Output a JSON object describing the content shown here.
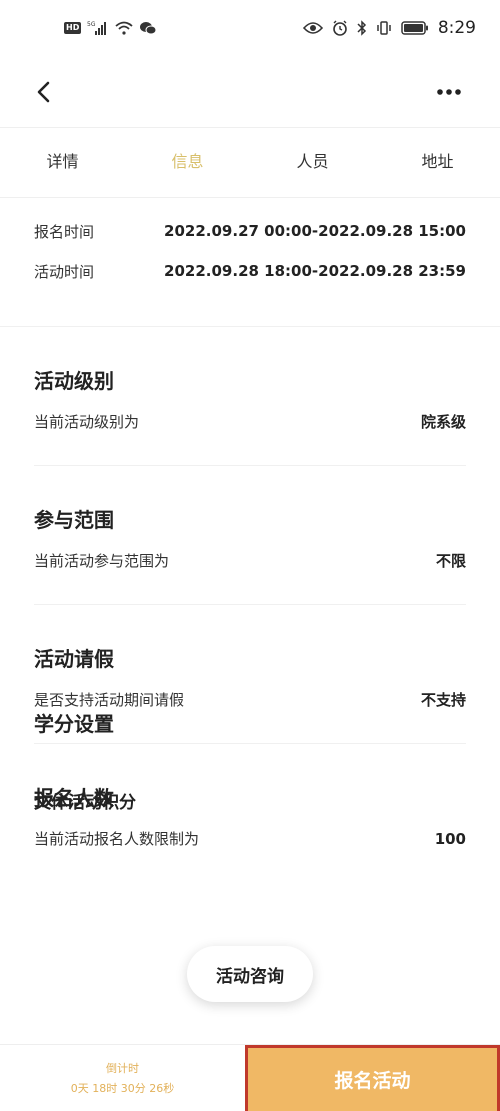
{
  "status_bar": {
    "hd": "HD",
    "network": "5G",
    "time": "8:29"
  },
  "tabs": [
    {
      "label": "详情"
    },
    {
      "label": "信息"
    },
    {
      "label": "人员"
    },
    {
      "label": "地址"
    }
  ],
  "active_tab": "信息",
  "times": {
    "signup_label": "报名时间",
    "signup_value": "2022.09.27 00:00-2022.09.28 15:00",
    "activity_label": "活动时间",
    "activity_value": "2022.09.28 18:00-2022.09.28 23:59"
  },
  "sections": {
    "level": {
      "title": "活动级别",
      "label": "当前活动级别为",
      "value": "院系级"
    },
    "scope": {
      "title": "参与范围",
      "label": "当前活动参与范围为",
      "value": "不限"
    },
    "leave": {
      "title": "活动请假",
      "label": "是否支持活动期间请假",
      "value": "不支持"
    },
    "capacity": {
      "title": "报名人数",
      "label": "当前活动报名人数限制为",
      "value": "100"
    }
  },
  "credits": {
    "title": "学分设置",
    "subtitle": "文体活动积分"
  },
  "consult_button": "活动咨询",
  "bottom": {
    "countdown_label": "倒计时",
    "countdown_value": "0天 18时 30分 26秒",
    "register_label": "报名活动"
  },
  "colors": {
    "accent": "#d8bf6a",
    "register_bg": "#f0b865",
    "highlight_border": "#c0392b"
  }
}
